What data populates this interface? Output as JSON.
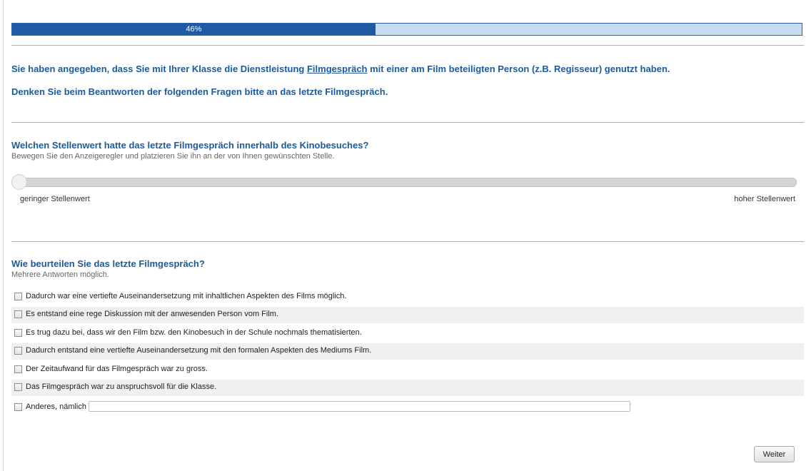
{
  "progress": {
    "value": 0.46,
    "label": "46%"
  },
  "intro": {
    "line1_before": "Sie haben angegeben, dass Sie mit Ihrer Klasse die Dienstleistung ",
    "line1_link": "Filmgespräch",
    "line1_after": " mit einer am Film beteiligten Person (z.B. Regisseur) genutzt haben.",
    "line2": "Denken Sie beim Beantworten der folgenden Fragen bitte an das letzte Filmgespräch."
  },
  "question1": {
    "title": "Welchen Stellenwert hatte das letzte Filmgespräch innerhalb des Kinobesuches?",
    "hint": "Bewegen Sie den Anzeigeregler und platzieren Sie ihn an der von Ihnen gewünschten Stelle.",
    "slider_value": 0,
    "label_min": "geringer Stellenwert",
    "label_max": "hoher Stellenwert"
  },
  "question2": {
    "title": "Wie beurteilen Sie das letzte Filmgespräch?",
    "hint": "Mehrere Antworten möglich.",
    "options": [
      {
        "label": "Dadurch war eine vertiefte Auseinandersetzung mit inhaltlichen Aspekten des Films möglich.",
        "checked": false
      },
      {
        "label": "Es entstand eine rege Diskussion mit der anwesenden Person vom Film.",
        "checked": false
      },
      {
        "label": "Es trug dazu bei, dass wir den Film bzw. den Kinobesuch in der Schule nochmals thematisierten.",
        "checked": false
      },
      {
        "label": "Dadurch entstand eine vertiefte Auseinandersetzung mit den formalen Aspekten des Mediums Film.",
        "checked": false
      },
      {
        "label": "Der Zeitaufwand für das Filmgespräch war zu gross.",
        "checked": false
      },
      {
        "label": "Das Filmgespräch war zu anspruchsvoll für die Klasse.",
        "checked": false
      },
      {
        "label": "Anderes, nämlich",
        "checked": false,
        "text_value": ""
      }
    ]
  },
  "buttons": {
    "next_label": "Weiter"
  }
}
